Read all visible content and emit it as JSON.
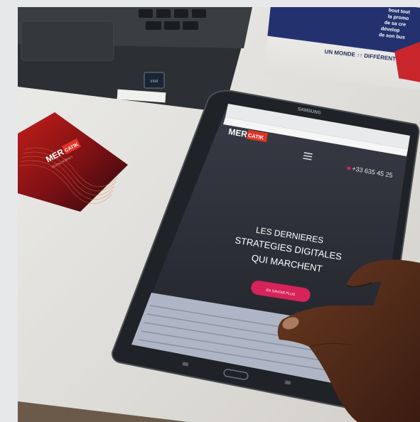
{
  "scene": {
    "laptop": {
      "badge_text": "intel"
    },
    "box": {
      "lines": [
        "bout tout",
        "la promo",
        "de sa cre",
        "dévelop",
        "de son bus"
      ],
      "slogan": "UN MONDE ↑↑ DIFFÉRENT"
    },
    "business_card": {
      "brand_part1": "MER",
      "brand_part2": "CATIK",
      "tagline": "DIGITAL AGENCY"
    },
    "tablet": {
      "maker": "SAMSUNG",
      "site": {
        "logo_part1": "MER",
        "logo_part2": "CATIK",
        "phone": "+33 635 45 25",
        "headline_line1": "LES DERNIERES",
        "headline_line2": "STRATEGIES DIGITALES",
        "headline_line3": "QUI MARCHENT",
        "cta_label": "EN SAVOIR PLUS"
      }
    }
  },
  "colors": {
    "accent": "#d6245a",
    "brand_red": "#e03327",
    "tablet_body": "#1f2226",
    "screen_dark": "#2b2e38"
  }
}
